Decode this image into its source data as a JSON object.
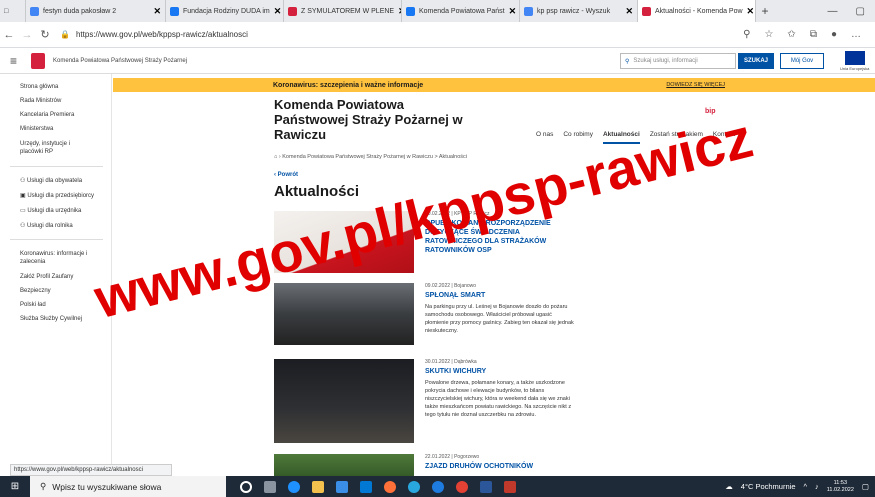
{
  "browser": {
    "tabs": [
      {
        "label": "festyn duda pakosław 2",
        "color": "#4285f4"
      },
      {
        "label": "Fundacja Rodziny DUDA im",
        "color": "#1877f2"
      },
      {
        "label": "Z SYMULATOREM W PLENE",
        "color": "#d4213d"
      },
      {
        "label": "Komenda Powiatowa Państ",
        "color": "#1877f2"
      },
      {
        "label": "kp psp rawicz - Wyszuk",
        "color": "#4285f4"
      },
      {
        "label": "Aktualności - Komenda Pow",
        "color": "#d4213d"
      }
    ],
    "url": "https://www.gov.pl/web/kppsp-rawicz/aktualnosci"
  },
  "header": {
    "institution": "Komenda Powiatowa Państwowej Straży Pożarnej",
    "search_placeholder": "Szukaj usługi, informacji",
    "search_button": "SZUKAJ",
    "moj_gov": "Mój Gov",
    "eu_label": "Unia Europejska"
  },
  "sidebar": {
    "top": [
      "Strona główna",
      "Rada Ministrów",
      "Kancelaria Premiera",
      "Ministerstwa",
      "Urzędy, instytucje i placówki RP"
    ],
    "services": [
      "Usługi dla obywatela",
      "Usługi dla przedsiębiorcy",
      "Usługi dla urzędnika",
      "Usługi dla rolnika"
    ],
    "bottom": [
      "Koronawirus: informacje i zalecenia",
      "Załóż Profil Zaufany",
      "Bezpieczny",
      "Polski ład",
      "Służba Służby Cywilnej"
    ]
  },
  "banner": {
    "text": "Koronawirus: szczepienia i ważne informacje",
    "more": "DOWIEDZ SIĘ WIĘCEJ"
  },
  "page": {
    "title": "Komenda Powiatowa Państwowej Straży Pożarnej w Rawiczu",
    "bip": "bip",
    "menu": [
      "O nas",
      "Co robimy",
      "Aktualności",
      "Zostań strażakiem",
      "Kontakt"
    ],
    "breadcrumb": "Komenda Powiatowa Państwowej Straży Pożarnej w Rawiczu  >  Aktualności",
    "back": "Powrót",
    "heading": "Aktualności"
  },
  "articles": [
    {
      "date": "10.02.2022 | KP PSP Rawicz",
      "title": "OPUBLIKOWANO ROZPORZĄDZENIE DOTYCZĄCE ŚWIADCZENIA RATOWNICZEGO DLA STRAŻAKÓW RATOWNIKÓW OSP",
      "lead": ""
    },
    {
      "date": "09.02.2022 | Bojanowo",
      "title": "SPŁONĄŁ SMART",
      "lead": "Na parkingu przy ul. Leśnej w Bojanowie doszło do pożaru samochodu osobowego. Właściciel próbował ugasić płomienie przy pomocy gaśnicy. Zabieg ten okazał się jednak nieskuteczny."
    },
    {
      "date": "30.01.2022 | Dąbrówka",
      "title": "SKUTKI WICHURY",
      "lead": "Powalone drzewa, połamane konary, a także uszkodzone pokrycia dachowe i elewacje budynków, to bilans niszczycielskiej wichury, która w weekend dała się we znaki także mieszkańcom powiatu rawickiego. Na szczęście nikt z tego tytułu nie doznał uszczerbku na zdrowiu."
    },
    {
      "date": "22.01.2022 | Pogorzewo",
      "title": "ZJAZD DRUHÓW OCHOTNIKÓW",
      "lead": ""
    }
  ],
  "watermark": "www.gov.pl/kppsp-rawicz",
  "status_url": "https://www.gov.pl/web/kppsp-rawicz/aktualnosci",
  "taskbar": {
    "search": "Wpisz tu wyszukiwane słowa",
    "weather": "4°C Pochmurnie",
    "time": "11:53",
    "date": "11.02.2022"
  }
}
